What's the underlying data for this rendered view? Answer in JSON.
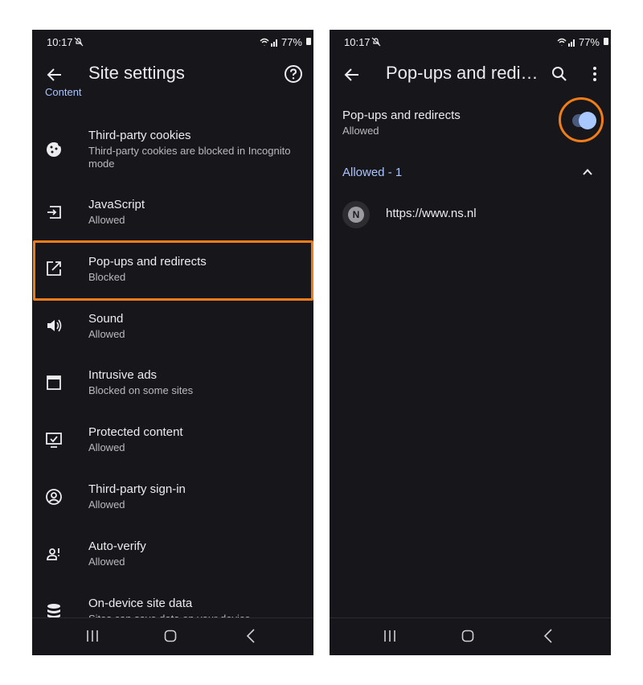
{
  "status_bar": {
    "time": "10:17",
    "battery": "77%"
  },
  "left_screen": {
    "title": "Site settings",
    "section_header": "Content",
    "settings": [
      {
        "icon": "cookie-icon",
        "title": "Third-party cookies",
        "subtitle": "Third-party cookies are blocked in Incognito mode"
      },
      {
        "icon": "javascript-icon",
        "title": "JavaScript",
        "subtitle": "Allowed"
      },
      {
        "icon": "open-in-new-icon",
        "title": "Pop-ups and redirects",
        "subtitle": "Blocked"
      },
      {
        "icon": "volume-icon",
        "title": "Sound",
        "subtitle": "Allowed"
      },
      {
        "icon": "window-icon",
        "title": "Intrusive ads",
        "subtitle": "Blocked on some sites"
      },
      {
        "icon": "monitor-check-icon",
        "title": "Protected content",
        "subtitle": "Allowed"
      },
      {
        "icon": "account-circle-icon",
        "title": "Third-party sign-in",
        "subtitle": "Allowed"
      },
      {
        "icon": "person-alert-icon",
        "title": "Auto-verify",
        "subtitle": "Allowed"
      },
      {
        "icon": "database-icon",
        "title": "On-device site data",
        "subtitle": "Sites can save data on your device"
      }
    ]
  },
  "right_screen": {
    "title": "Pop-ups and redi…",
    "toggle": {
      "title": "Pop-ups and redirects",
      "subtitle": "Allowed",
      "enabled": true
    },
    "allowed_header": "Allowed - 1",
    "sites": [
      {
        "favicon_letter": "N",
        "url": "https://www.ns.nl"
      }
    ]
  },
  "colors": {
    "background": "#17171b",
    "accent": "#a8c4ff",
    "highlight": "#f07d1a"
  }
}
